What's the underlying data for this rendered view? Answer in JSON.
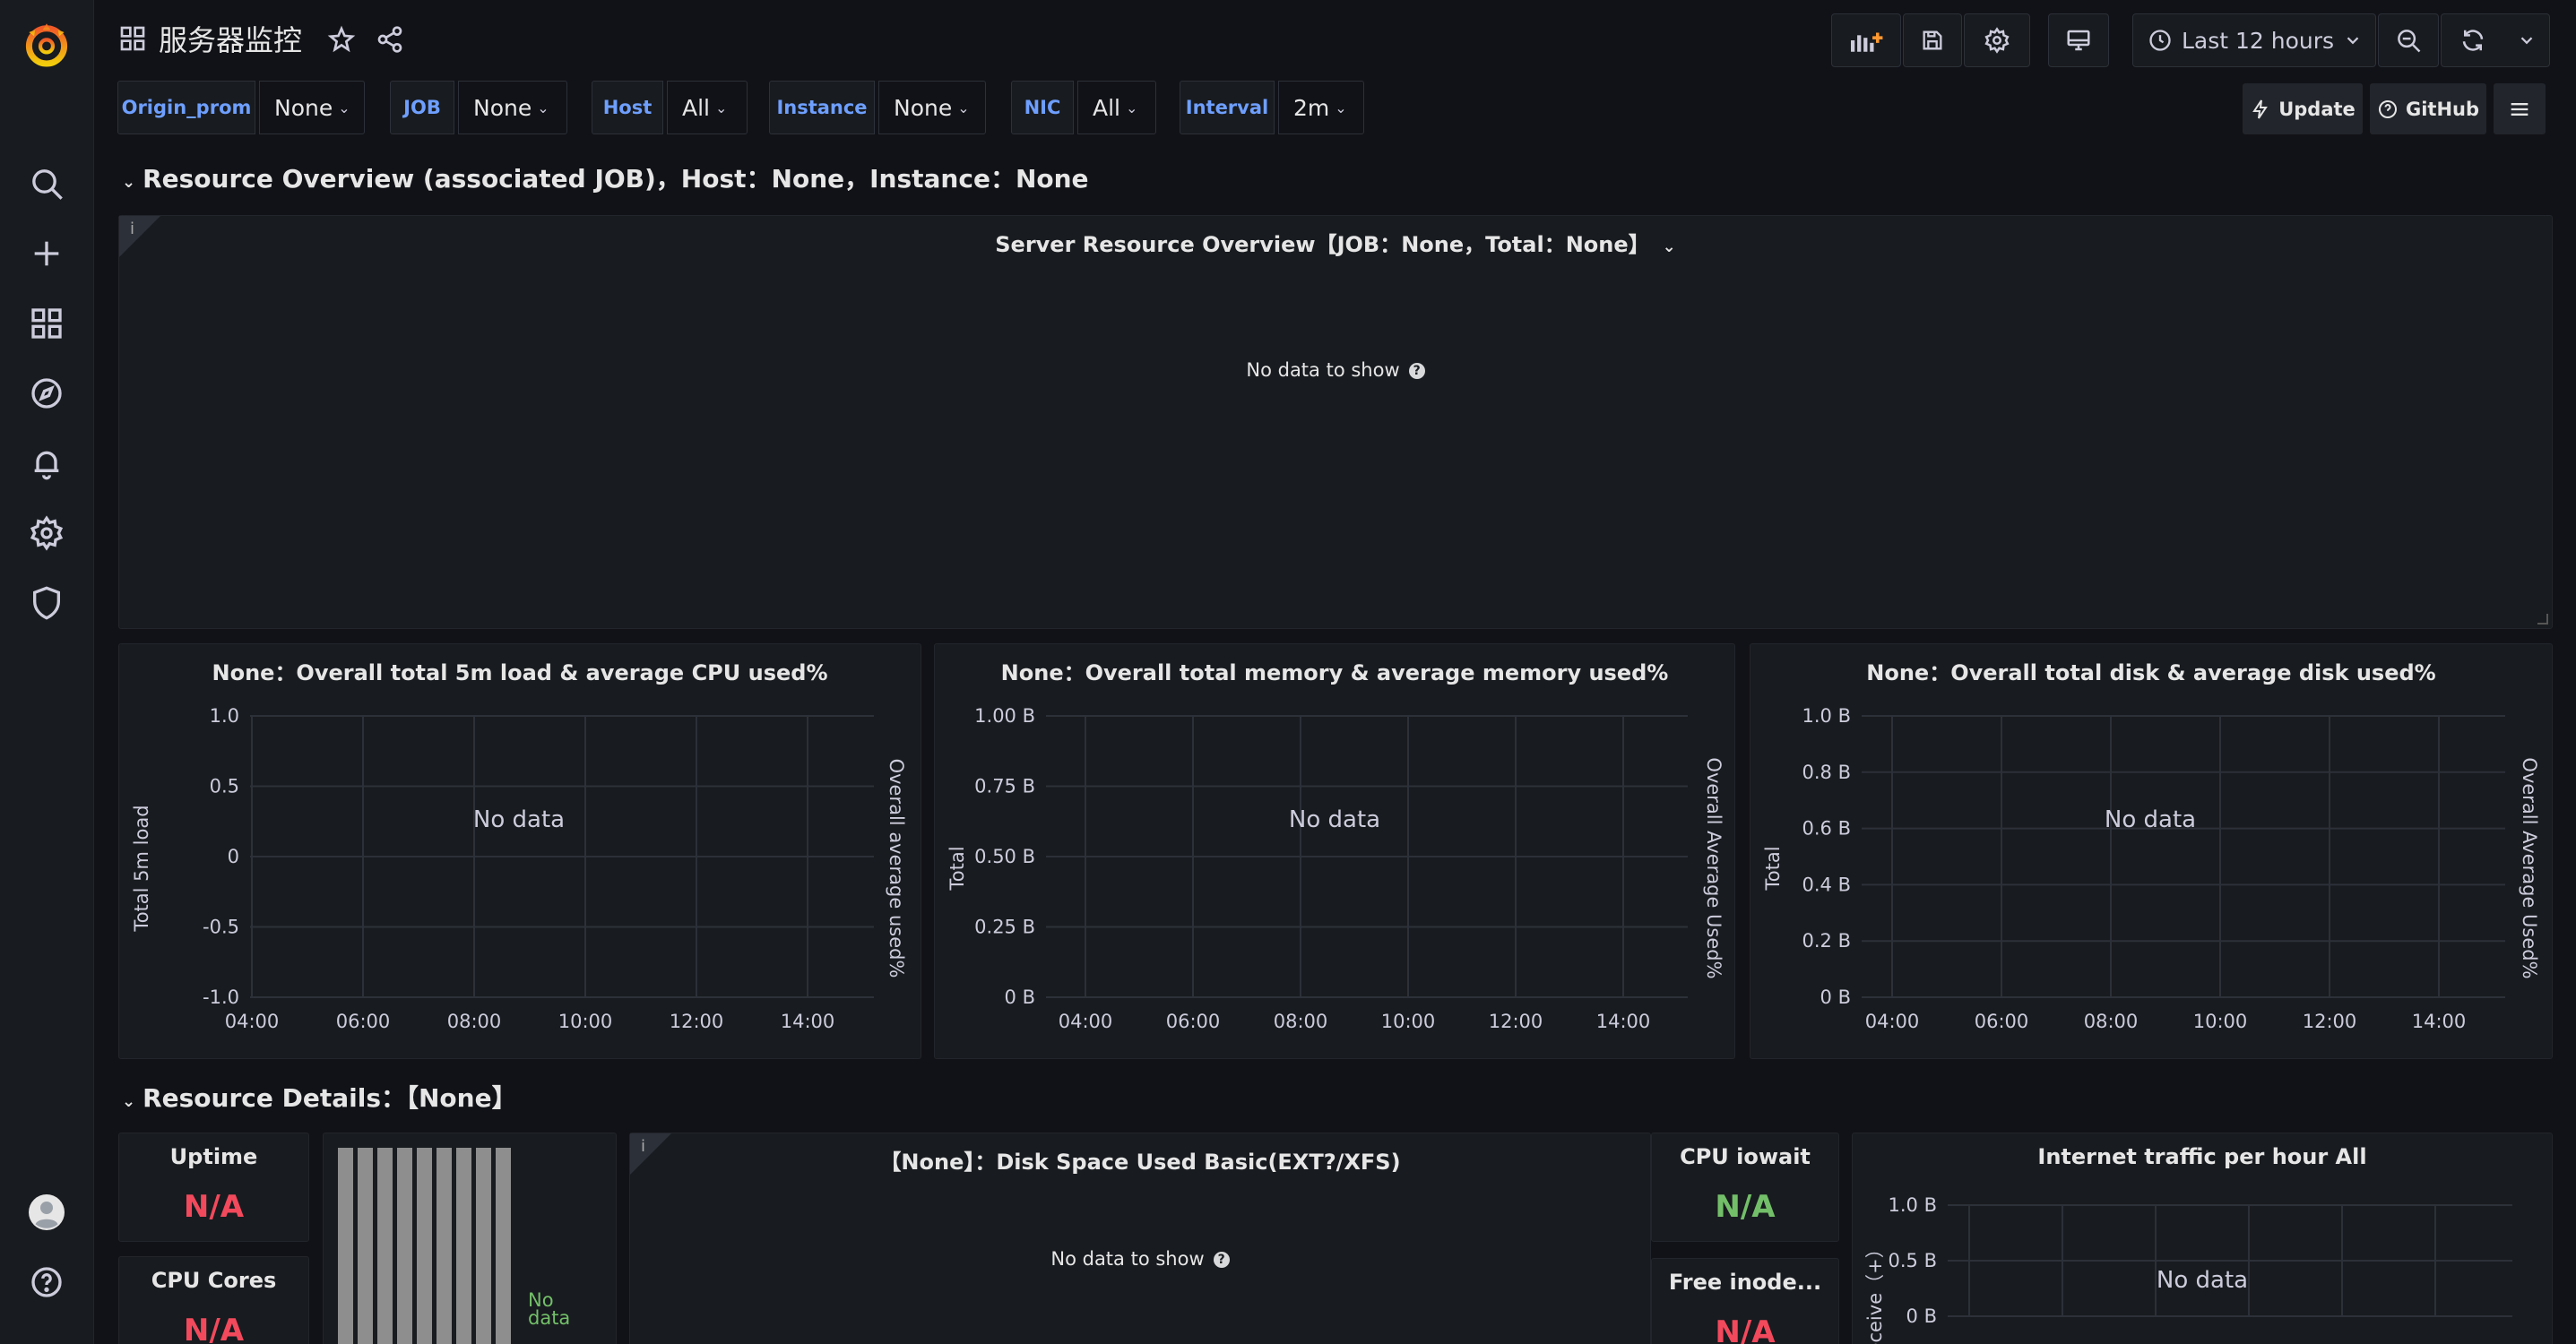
{
  "app": {
    "dashboard_title": "服务器监控"
  },
  "colors": {
    "accent": "#6e9fff",
    "red": "#f2495c",
    "green": "#73bf69",
    "bg": "#111217",
    "panel": "#181b1f"
  },
  "sidebar": {
    "items": [
      {
        "name": "grafana-logo-icon"
      },
      {
        "name": "search-icon"
      },
      {
        "name": "plus-icon"
      },
      {
        "name": "dashboards-grid-icon"
      },
      {
        "name": "explore-compass-icon"
      },
      {
        "name": "alerting-bell-icon"
      },
      {
        "name": "configuration-gear-icon"
      },
      {
        "name": "server-admin-shield-icon"
      },
      {
        "name": "user-avatar-icon"
      },
      {
        "name": "help-icon"
      }
    ]
  },
  "toolbar": {
    "time_range": "Last 12 hours",
    "icons": [
      "add-panel-icon",
      "save-icon",
      "settings-icon",
      "tv-mode-icon",
      "clock-icon",
      "zoom-out-icon",
      "refresh-icon",
      "chevron-down-icon"
    ]
  },
  "variables": [
    {
      "label": "Origin_prom",
      "value": "None"
    },
    {
      "label": "JOB",
      "value": "None"
    },
    {
      "label": "Host",
      "value": "All"
    },
    {
      "label": "Instance",
      "value": "None"
    },
    {
      "label": "NIC",
      "value": "All"
    },
    {
      "label": "Interval",
      "value": "2m"
    }
  ],
  "links": {
    "update": "Update",
    "github": "GitHub"
  },
  "rows": {
    "overview": "Resource Overview (associated JOB)，Host：None，Instance：None",
    "details": "Resource Details：【None】"
  },
  "panels": {
    "server_overview": {
      "title": "Server Resource Overview【JOB：None，Total：None】",
      "empty": "No data to show"
    },
    "cpu": {
      "title": "None：Overall total 5m load & average CPU used%",
      "empty": "No data",
      "ylabel_left": "Total 5m load",
      "ylabel_right": "Overall average used%"
    },
    "memory": {
      "title": "None：Overall total memory & average memory used%",
      "empty": "No data",
      "ylabel_left": "Total",
      "ylabel_right": "Overall Average Used%"
    },
    "disk": {
      "title": "None：Overall total disk & average disk used%",
      "empty": "No data",
      "ylabel_left": "Total",
      "ylabel_right": "Overall Average Used%"
    },
    "uptime": {
      "title": "Uptime",
      "value": "N/A"
    },
    "cpu_cores": {
      "title": "CPU Cores",
      "value": "N/A"
    },
    "bar_gauge": {
      "empty_line1": "No",
      "empty_line2": "data"
    },
    "disk_space": {
      "title": "【None】：Disk Space Used Basic(EXT?/XFS)",
      "empty": "No data to show"
    },
    "cpu_iowait": {
      "title": "CPU iowait",
      "value": "N/A"
    },
    "free_inodes": {
      "title": "Free inode...",
      "value": "N/A"
    },
    "internet": {
      "title": "Internet traffic per hour All",
      "empty": "No data",
      "ylabel_left": "/receive（+）"
    }
  },
  "chart_data": [
    {
      "type": "line",
      "title": "None：Overall total 5m load & average CPU used%",
      "x": [
        "04:00",
        "06:00",
        "08:00",
        "10:00",
        "12:00",
        "14:00"
      ],
      "y_ticks": [
        "1.0",
        "0.5",
        "0",
        "-0.5",
        "-1.0"
      ],
      "ylim": [
        -1.0,
        1.0
      ],
      "ylabel": "Total 5m load",
      "ylabel_right": "Overall average used%",
      "series": [],
      "grid": true
    },
    {
      "type": "line",
      "title": "None：Overall total memory & average memory used%",
      "x": [
        "04:00",
        "06:00",
        "08:00",
        "10:00",
        "12:00",
        "14:00"
      ],
      "y_ticks": [
        "1.00 B",
        "0.75 B",
        "0.50 B",
        "0.25 B",
        "0 B"
      ],
      "ylim": [
        0,
        1.0
      ],
      "ylabel": "Total",
      "ylabel_right": "Overall Average Used%",
      "series": [],
      "grid": true
    },
    {
      "type": "line",
      "title": "None：Overall total disk & average disk used%",
      "x": [
        "04:00",
        "06:00",
        "08:00",
        "10:00",
        "12:00",
        "14:00"
      ],
      "y_ticks": [
        "1.0 B",
        "0.8 B",
        "0.6 B",
        "0.4 B",
        "0.2 B",
        "0 B"
      ],
      "ylim": [
        0,
        1.0
      ],
      "ylabel": "Total",
      "ylabel_right": "Overall Average Used%",
      "series": [],
      "grid": true
    },
    {
      "type": "line",
      "title": "Internet traffic per hour All",
      "x": [],
      "y_ticks": [
        "1.0 B",
        "0.5 B",
        "0 B"
      ],
      "ylabel": "/receive（+）",
      "series": [],
      "grid": true
    }
  ]
}
